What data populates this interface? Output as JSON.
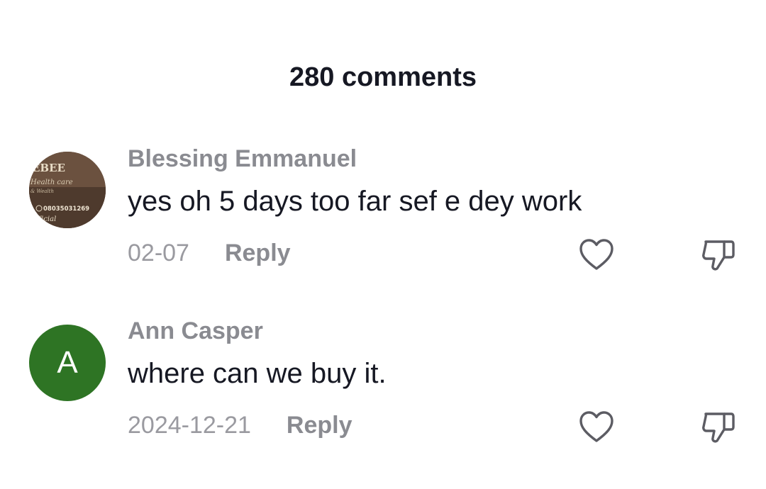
{
  "header": {
    "comments_count": "280 comments"
  },
  "comments": [
    {
      "author": "Blessing Emmanuel",
      "text": "yes oh 5 days too far sef e dey work",
      "date": "02-07",
      "reply_label": "Reply",
      "avatar": {
        "type": "image",
        "lines": [
          "EBEE",
          "Health care",
          "& Wealth",
          "08035031269",
          "official"
        ]
      }
    },
    {
      "author": "Ann Casper",
      "text": "where can we buy it.",
      "date": "2024-12-21",
      "reply_label": "Reply",
      "avatar": {
        "type": "letter",
        "letter": "A",
        "color": "#2e7424"
      }
    }
  ],
  "icons": {
    "like": "heart-icon",
    "dislike": "thumbs-down-icon"
  },
  "colors": {
    "text_primary": "#161823",
    "text_secondary": "#8a8b91",
    "avatar_green": "#2e7424"
  }
}
